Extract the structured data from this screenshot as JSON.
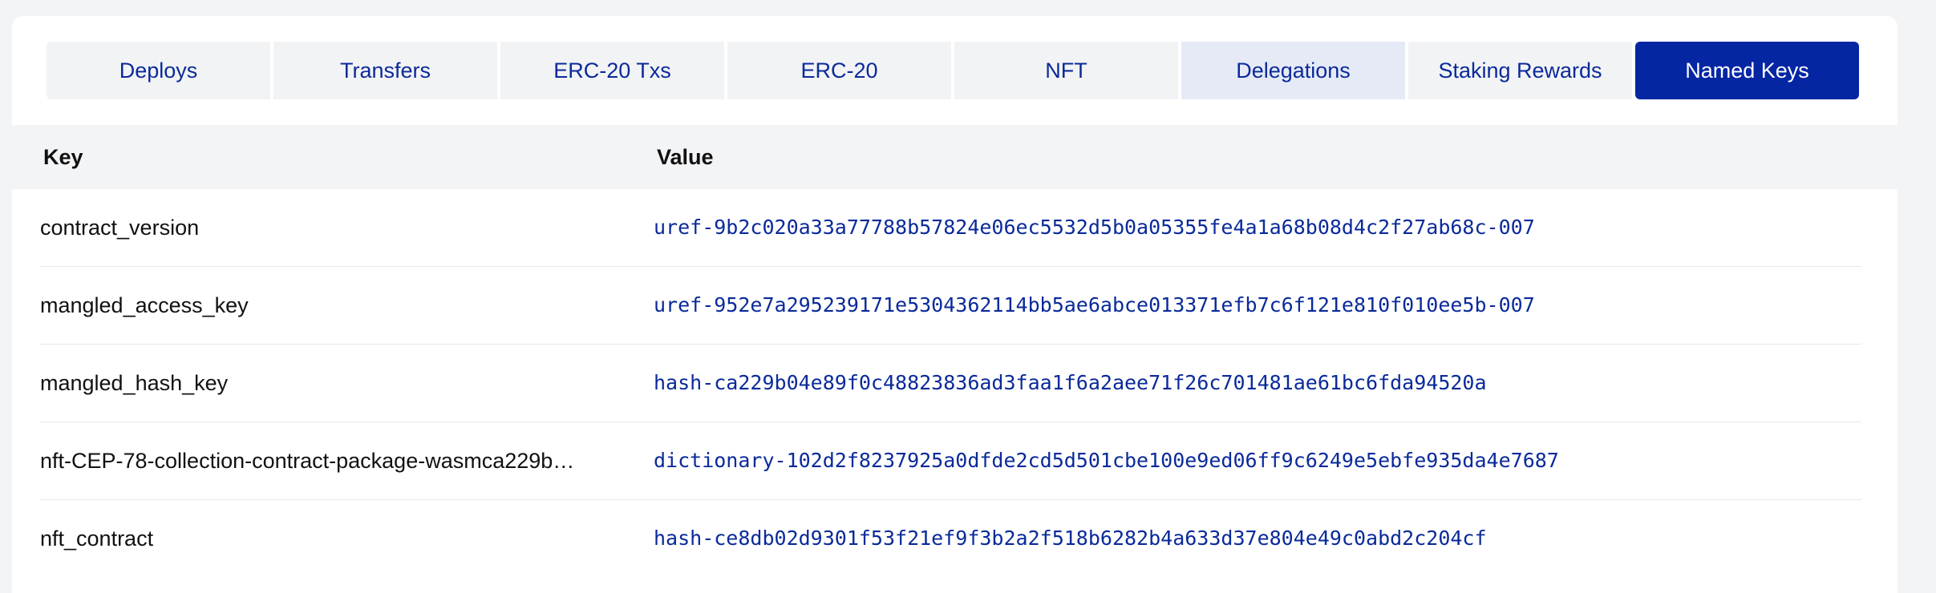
{
  "tabs": [
    {
      "label": "Deploys"
    },
    {
      "label": "Transfers"
    },
    {
      "label": "ERC-20 Txs"
    },
    {
      "label": "ERC-20"
    },
    {
      "label": "NFT"
    },
    {
      "label": "Delegations"
    },
    {
      "label": "Staking Rewards"
    },
    {
      "label": "Named Keys"
    }
  ],
  "active_tab": "Named Keys",
  "table": {
    "headers": {
      "key": "Key",
      "value": "Value"
    },
    "rows": [
      {
        "key": "contract_version",
        "value": "uref-9b2c020a33a77788b57824e06ec5532d5b0a05355fe4a1a68b08d4c2f27ab68c-007"
      },
      {
        "key": "mangled_access_key",
        "value": "uref-952e7a295239171e5304362114bb5ae6abce013371efb7c6f121e810f010ee5b-007"
      },
      {
        "key": "mangled_hash_key",
        "value": "hash-ca229b04e89f0c48823836ad3faa1f6a2aee71f26c701481ae61bc6fda94520a"
      },
      {
        "key": "nft-CEP-78-collection-contract-package-wasmca229b…",
        "value": "dictionary-102d2f8237925a0dfde2cd5d501cbe100e9ed06ff9c6249e5ebfe935da4e7687"
      },
      {
        "key": "nft_contract",
        "value": "hash-ce8db02d9301f53f21ef9f3b2a2f518b6282b4a633d37e804e49c0abd2c204cf"
      }
    ]
  },
  "colors": {
    "accent": "#0426a3",
    "link": "#0a2a9a",
    "page_bg": "#f3f4f6",
    "tab_bg": "#f2f3f5",
    "tab_hover_bg": "#e6eaf7"
  }
}
